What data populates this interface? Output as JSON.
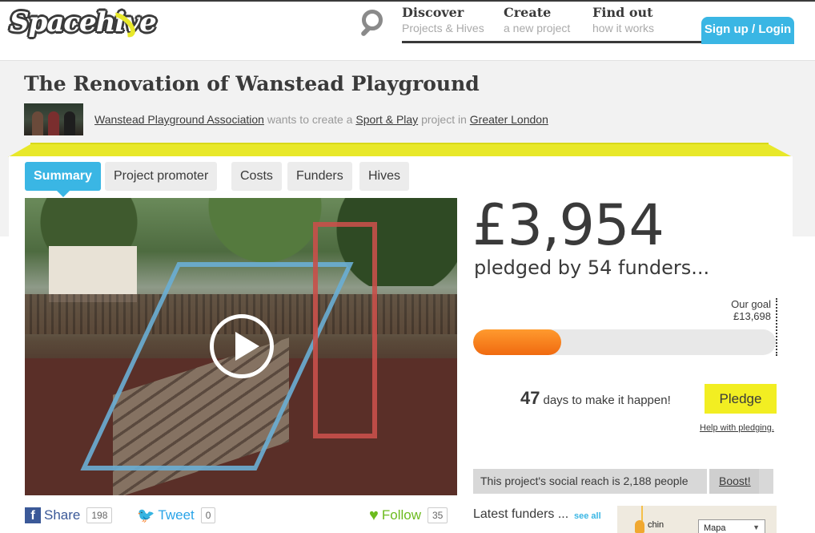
{
  "header": {
    "logo": "Spacehive",
    "nav": [
      {
        "title": "Discover",
        "sub": "Projects & Hives"
      },
      {
        "title": "Create",
        "sub": "a new project"
      },
      {
        "title": "Find out",
        "sub": "how it works"
      }
    ],
    "signup_label": "Sign up / Login"
  },
  "project": {
    "title": "The Renovation of Wanstead Playground",
    "promoter": "Wanstead Playground Association",
    "byline_1": "wants to create a",
    "category": "Sport & Play",
    "byline_2": "project in",
    "location": "Greater London"
  },
  "tabs": [
    "Summary",
    "Project promoter",
    "Costs",
    "Funders",
    "Hives"
  ],
  "share": {
    "facebook_label": "Share",
    "facebook_count": "198",
    "twitter_label": "Tweet",
    "twitter_count": "0",
    "follow_label": "Follow",
    "follow_count": "35"
  },
  "funding": {
    "amount": "£3,954",
    "pledged_text": "pledged by 54 funders...",
    "goal_label": "Our goal",
    "goal_value": "£13,698",
    "progress_fraction": 0.29,
    "days": "47",
    "days_text": "days to make it happen!",
    "pledge_label": "Pledge",
    "help_label": "Help with pledging."
  },
  "reach": {
    "text": "This project's social reach is 2,188 people",
    "boost_label": "Boost!"
  },
  "latest": {
    "label": "Latest funders ...",
    "see_all": "see all",
    "map_label": "chin",
    "map_select": "Mapa"
  },
  "colors": {
    "accent_blue": "#3ab6e4",
    "pledge_yellow": "#f2ee22",
    "progress_orange": "#f07a14",
    "roof_yellow": "#e8e82a"
  }
}
